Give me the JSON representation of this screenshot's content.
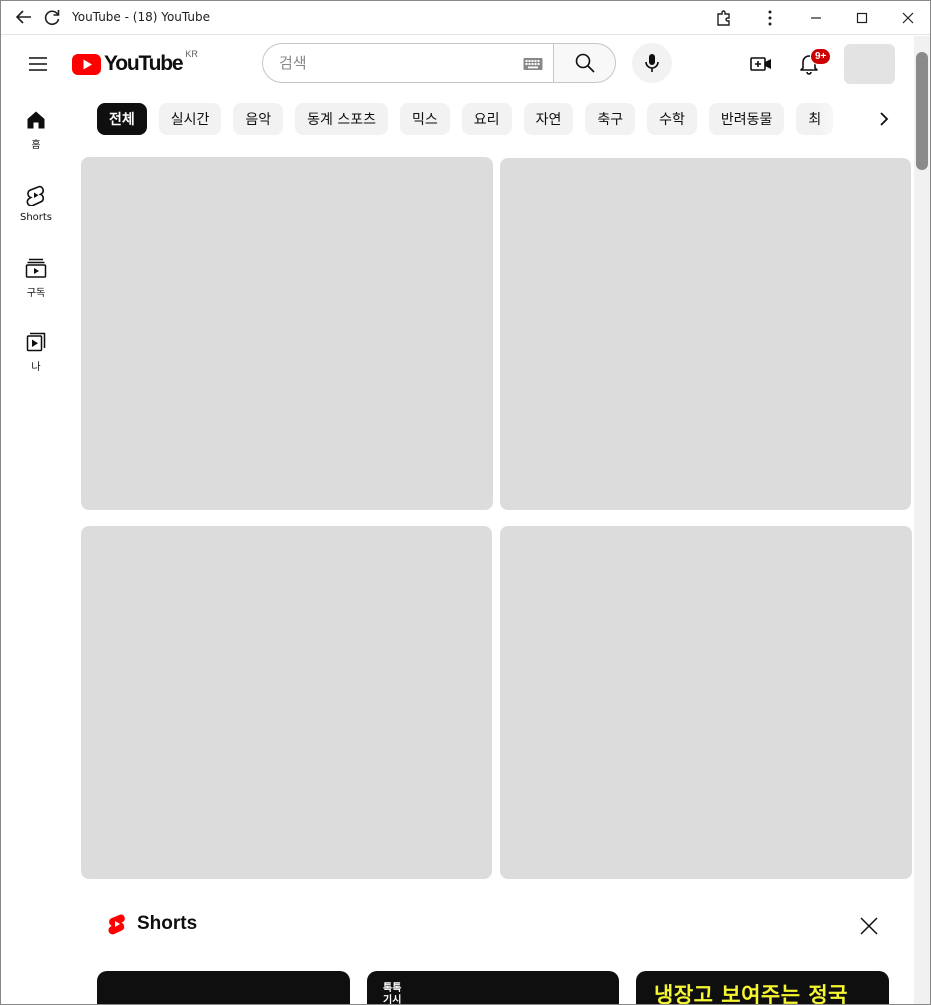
{
  "window": {
    "title": "YouTube - (18) YouTube"
  },
  "masthead": {
    "logo_text": "YouTube",
    "region": "KR",
    "search_placeholder": "검색",
    "notification_count": "9+"
  },
  "guide": {
    "items": [
      {
        "label": "홈",
        "icon": "home-icon"
      },
      {
        "label": "Shorts",
        "icon": "shorts-icon"
      },
      {
        "label": "구독",
        "icon": "subscriptions-icon"
      },
      {
        "label": "나",
        "icon": "you-icon"
      }
    ]
  },
  "chips": [
    "전체",
    "실시간",
    "음악",
    "동계 스포츠",
    "믹스",
    "요리",
    "자연",
    "축구",
    "수학",
    "반려동물",
    "최"
  ],
  "shorts": {
    "title": "Shorts",
    "items": [
      {
        "text": ""
      },
      {
        "text": "톡톡 기시"
      },
      {
        "text": "냉장고 보여주는 정국"
      }
    ]
  },
  "colors": {
    "brand_red": "#ff0000",
    "chip_active": "#0f0f0f",
    "chip_bg": "#f2f2f2",
    "placeholder_card": "#dcdcdc",
    "badge_red": "#cc0000"
  }
}
